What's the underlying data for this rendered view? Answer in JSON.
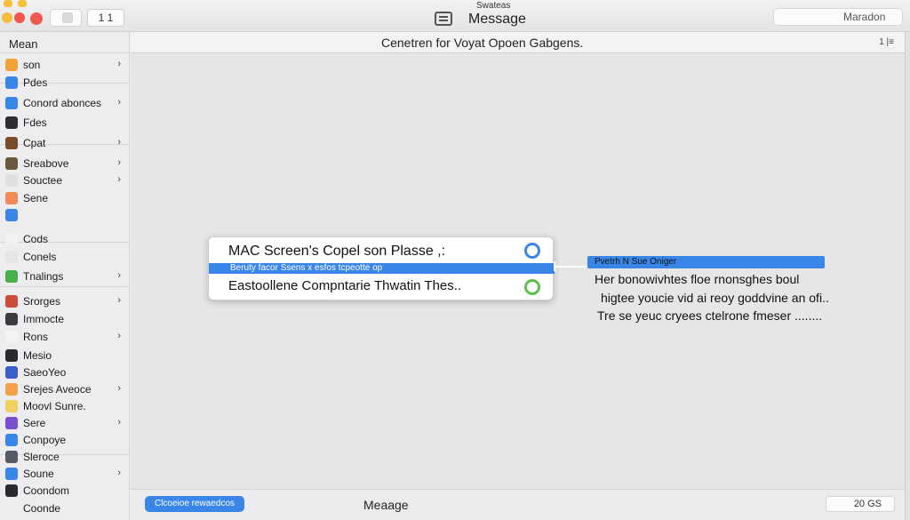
{
  "window": {
    "title": "Message",
    "subtitle": "Swateas",
    "pager_label": "1 1",
    "search_text": "Maradon"
  },
  "sidebar": {
    "header": "Mean",
    "items": [
      {
        "label": "son",
        "icon": "sun-icon",
        "color": "#f3a23a",
        "chevron": true
      },
      {
        "label": "Pdes",
        "icon": "doc-icon",
        "color": "#3a86e8",
        "chevron": false
      },
      {
        "label": "Conord abonces",
        "icon": "gear-icon",
        "color": "#3a86e8",
        "chevron": true
      },
      {
        "label": "Fdes",
        "icon": "folder-icon",
        "color": "#2f2f33",
        "chevron": false
      },
      {
        "label": "Cpat",
        "icon": "box-icon",
        "color": "#7a4b2a",
        "chevron": true
      },
      {
        "label": "Sreabove",
        "icon": "drive-icon",
        "color": "#6b5a3f",
        "chevron": true
      },
      {
        "label": "Souctee",
        "icon": "blank-icon",
        "color": "#e0e0e2",
        "chevron": true
      },
      {
        "label": "Sene",
        "icon": "tag-icon",
        "color": "#f08a5a",
        "chevron": false
      },
      {
        "label": "",
        "icon": "phone-icon",
        "color": "#3a86e8",
        "chevron": false
      },
      {
        "label": "Cods",
        "icon": "note-icon",
        "color": "#f1f1f1",
        "chevron": false
      },
      {
        "label": "Conels",
        "icon": "blank-icon",
        "color": "#e5e5e7",
        "chevron": false
      },
      {
        "label": "Tnalings",
        "icon": "refresh-icon",
        "color": "#48b04a",
        "chevron": true
      },
      {
        "label": "Srorges",
        "icon": "sliders-icon",
        "color": "#cc4b3b",
        "chevron": true
      },
      {
        "label": "Immocte",
        "icon": "window-icon",
        "color": "#3b3b40",
        "chevron": false
      },
      {
        "label": "Rons",
        "icon": "blank-icon",
        "color": "#f3f3f4",
        "chevron": true
      },
      {
        "label": "Mesio",
        "icon": "trash-icon",
        "color": "#2a2a2e",
        "chevron": false
      },
      {
        "label": "SaeoYeo",
        "icon": "photo-icon",
        "color": "#3a5fc8",
        "chevron": false
      },
      {
        "label": "Srejes Aveoce",
        "icon": "grid-icon",
        "color": "#f1a14a",
        "chevron": true
      },
      {
        "label": "Moovl Sunre.",
        "icon": "blank-icon",
        "color": "#f0d060",
        "chevron": false
      },
      {
        "label": "Sere",
        "icon": "music-icon",
        "color": "#7a4fd0",
        "chevron": true
      },
      {
        "label": "Conpoye",
        "icon": "globe-icon",
        "color": "#3a86e8",
        "chevron": false
      },
      {
        "label": "Sleroce",
        "icon": "camera-icon",
        "color": "#555a66",
        "chevron": false
      },
      {
        "label": "Soune",
        "icon": "cloud-icon",
        "color": "#3a86e8",
        "chevron": true
      },
      {
        "label": "Coondom",
        "icon": "phone-dark-icon",
        "color": "#2a2a2e",
        "chevron": false
      },
      {
        "label": "Coonde",
        "icon": "blank-icon",
        "color": "#eeeef0",
        "chevron": false
      }
    ]
  },
  "main": {
    "header_title": "Cenetren for Voyat Opoen Gabgens.",
    "header_icon": "1 |≡"
  },
  "dialog": {
    "title": "MAC Screen's Copel son Plasse ,:",
    "band_text": "Beruty facor Ssens x   esfos tcpeotte op",
    "row_text": "Eastoollene Compntarie Thwatin Thes.."
  },
  "info": {
    "band_text": "Pvetrh N  Sue Oniger",
    "lines": [
      "Her bonowivhtes floe rnonsghes boul",
      "higtee youcie vid ai reoy goddvine an ofi..",
      "Tre se yeuc cryees ctelrone fmeser ........"
    ]
  },
  "bottom": {
    "button_label": "Clcoeioe rewaedcos",
    "title": "Meaage",
    "counter": "20 GS"
  }
}
